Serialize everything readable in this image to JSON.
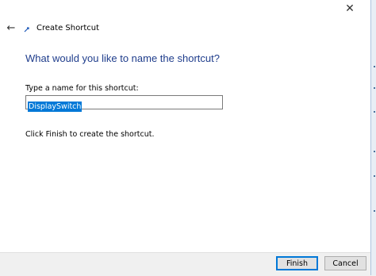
{
  "window": {
    "title": "Create Shortcut",
    "close_glyph": "✕",
    "back_glyph": "←",
    "app_icon": "shortcut-icon"
  },
  "content": {
    "heading": "What would you like to name the shortcut?",
    "name_label": "Type a name for this shortcut:",
    "name_value": "DisplaySwitch",
    "info_text": "Click Finish to create the shortcut."
  },
  "buttons": {
    "finish": "Finish",
    "cancel": "Cancel"
  },
  "colors": {
    "heading": "#1f3d8c",
    "selection": "#0078d7",
    "footer": "#f0f0f0"
  }
}
